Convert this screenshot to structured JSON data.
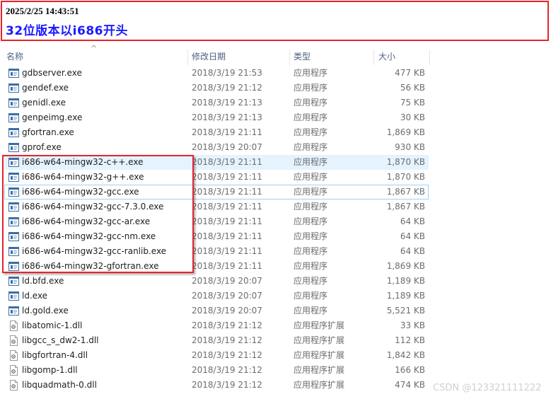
{
  "annotation": {
    "timestamp": "2025/2/25 14:43:51",
    "note": "32位版本以i686开头"
  },
  "columns": {
    "name": "名称",
    "date": "修改日期",
    "type": "类型",
    "size": "大小"
  },
  "files": [
    {
      "name": "gdbserver.exe",
      "date": "2018/3/19 21:53",
      "type": "应用程序",
      "size": "477 KB",
      "icon": "exe-icon"
    },
    {
      "name": "gendef.exe",
      "date": "2018/3/19 21:12",
      "type": "应用程序",
      "size": "56 KB",
      "icon": "exe-icon"
    },
    {
      "name": "genidl.exe",
      "date": "2018/3/19 21:13",
      "type": "应用程序",
      "size": "75 KB",
      "icon": "exe-icon"
    },
    {
      "name": "genpeimg.exe",
      "date": "2018/3/19 21:13",
      "type": "应用程序",
      "size": "30 KB",
      "icon": "exe-icon"
    },
    {
      "name": "gfortran.exe",
      "date": "2018/3/19 21:11",
      "type": "应用程序",
      "size": "1,869 KB",
      "icon": "exe-icon"
    },
    {
      "name": "gprof.exe",
      "date": "2018/3/19 20:07",
      "type": "应用程序",
      "size": "930 KB",
      "icon": "exe-icon"
    },
    {
      "name": "i686-w64-mingw32-c++.exe",
      "date": "2018/3/19 21:11",
      "type": "应用程序",
      "size": "1,870 KB",
      "icon": "exe-icon",
      "state": "hover"
    },
    {
      "name": "i686-w64-mingw32-g++.exe",
      "date": "2018/3/19 21:11",
      "type": "应用程序",
      "size": "1,870 KB",
      "icon": "exe-icon"
    },
    {
      "name": "i686-w64-mingw32-gcc.exe",
      "date": "2018/3/19 21:11",
      "type": "应用程序",
      "size": "1,867 KB",
      "icon": "exe-icon",
      "state": "focus"
    },
    {
      "name": "i686-w64-mingw32-gcc-7.3.0.exe",
      "date": "2018/3/19 21:11",
      "type": "应用程序",
      "size": "1,867 KB",
      "icon": "exe-icon"
    },
    {
      "name": "i686-w64-mingw32-gcc-ar.exe",
      "date": "2018/3/19 21:11",
      "type": "应用程序",
      "size": "64 KB",
      "icon": "exe-icon"
    },
    {
      "name": "i686-w64-mingw32-gcc-nm.exe",
      "date": "2018/3/19 21:11",
      "type": "应用程序",
      "size": "64 KB",
      "icon": "exe-icon"
    },
    {
      "name": "i686-w64-mingw32-gcc-ranlib.exe",
      "date": "2018/3/19 21:11",
      "type": "应用程序",
      "size": "64 KB",
      "icon": "exe-icon"
    },
    {
      "name": "i686-w64-mingw32-gfortran.exe",
      "date": "2018/3/19 21:11",
      "type": "应用程序",
      "size": "1,869 KB",
      "icon": "exe-icon"
    },
    {
      "name": "ld.bfd.exe",
      "date": "2018/3/19 20:07",
      "type": "应用程序",
      "size": "1,189 KB",
      "icon": "exe-icon"
    },
    {
      "name": "ld.exe",
      "date": "2018/3/19 20:07",
      "type": "应用程序",
      "size": "1,189 KB",
      "icon": "exe-icon"
    },
    {
      "name": "ld.gold.exe",
      "date": "2018/3/19 20:07",
      "type": "应用程序",
      "size": "5,521 KB",
      "icon": "exe-icon"
    },
    {
      "name": "libatomic-1.dll",
      "date": "2018/3/19 21:12",
      "type": "应用程序扩展",
      "size": "33 KB",
      "icon": "dll-icon"
    },
    {
      "name": "libgcc_s_dw2-1.dll",
      "date": "2018/3/19 21:12",
      "type": "应用程序扩展",
      "size": "112 KB",
      "icon": "dll-icon"
    },
    {
      "name": "libgfortran-4.dll",
      "date": "2018/3/19 21:12",
      "type": "应用程序扩展",
      "size": "1,842 KB",
      "icon": "dll-icon"
    },
    {
      "name": "libgomp-1.dll",
      "date": "2018/3/19 21:12",
      "type": "应用程序扩展",
      "size": "166 KB",
      "icon": "dll-icon"
    },
    {
      "name": "libquadmath-0.dll",
      "date": "2018/3/19 21:12",
      "type": "应用程序扩展",
      "size": "474 KB",
      "icon": "dll-icon"
    }
  ],
  "watermark": "CSDN @123321111222"
}
